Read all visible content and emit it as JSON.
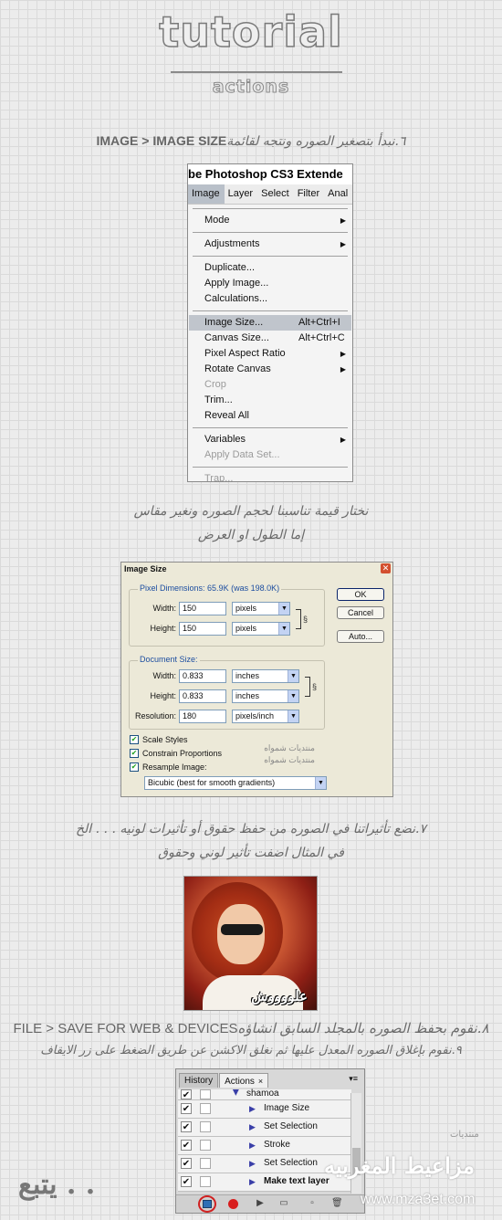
{
  "header": {
    "title": "tutorial",
    "subtitle": "actions"
  },
  "step6": {
    "arabic": "٦.نبدأ بتصغير الصوره ونتجه لقائمة",
    "english": "IMAGE > IMAGE SIZE"
  },
  "photoshop": {
    "window_title": "be Photoshop CS3 Extende",
    "menubar": [
      "Image",
      "Layer",
      "Select",
      "Filter",
      "Anal"
    ],
    "menu_items": {
      "mode": "Mode",
      "adjustments": "Adjustments",
      "duplicate": "Duplicate...",
      "apply_image": "Apply Image...",
      "calculations": "Calculations...",
      "image_size": "Image Size...",
      "image_size_shortcut": "Alt+Ctrl+I",
      "canvas_size": "Canvas Size...",
      "canvas_size_shortcut": "Alt+Ctrl+C",
      "pixel_aspect": "Pixel Aspect Ratio",
      "rotate_canvas": "Rotate Canvas",
      "crop": "Crop",
      "trim": "Trim...",
      "reveal_all": "Reveal All",
      "variables": "Variables",
      "apply_data_set": "Apply Data Set...",
      "trap": "Trap..."
    }
  },
  "note1": {
    "line1": "نختار قيمة تناسبنا لحجم الصوره ونغير مقاس",
    "line2": "إما الطول او العرض"
  },
  "image_size_dialog": {
    "title": "Image Size",
    "pixel_dimensions_label": "Pixel Dimensions:",
    "pixel_dimensions_value": "65.9K (was 198.0K)",
    "width_label": "Width:",
    "width_value": "150",
    "width_unit": "pixels",
    "height_label": "Height:",
    "height_value": "150",
    "height_unit": "pixels",
    "document_size_label": "Document Size:",
    "doc_width_label": "Width:",
    "doc_width_value": "0.833",
    "doc_width_unit": "inches",
    "doc_height_label": "Height:",
    "doc_height_value": "0.833",
    "doc_height_unit": "inches",
    "resolution_label": "Resolution:",
    "resolution_value": "180",
    "resolution_unit": "pixels/inch",
    "scale_styles": "Scale Styles",
    "constrain_proportions": "Constrain Proportions",
    "resample_image": "Resample Image:",
    "resample_method": "Bicubic (best for smooth gradients)",
    "ok": "OK",
    "cancel": "Cancel",
    "auto": "Auto...",
    "watermark1": "منتديات شمواه",
    "watermark2": "منتديات شمواه"
  },
  "step7": {
    "line1": "٧.نضع تأثيراتنا في الصوره من حفظ حقوق أو تأثيرات لونيه . . . الخ",
    "line2": "في المثال اضفت تأثير لوني وحقوق"
  },
  "photo": {
    "signature": "علووووش"
  },
  "step8": {
    "english": "FILE > SAVE FOR WEB & DEVICES",
    "arabic": "٨.نقوم بحفظ الصوره بالمجلد السابق انشاؤه"
  },
  "step9": {
    "arabic": "٩.نقوم بإغلاق الصوره المعدل عليها ثم نغلق الاكشن عن طريق الضغط على زر الايقاف"
  },
  "actions_panel": {
    "tab_history": "History",
    "tab_actions": "Actions",
    "tab_close": "×",
    "set_name": "shamoa",
    "rows": [
      "Image Size",
      "Set Selection",
      "Stroke",
      "Set Selection",
      "Make text layer"
    ]
  },
  "footer": {
    "follow": "يتبع . .",
    "brand": "مزاعيط المغربيه",
    "url": "www.mza3et.com",
    "small": "منتديات"
  }
}
